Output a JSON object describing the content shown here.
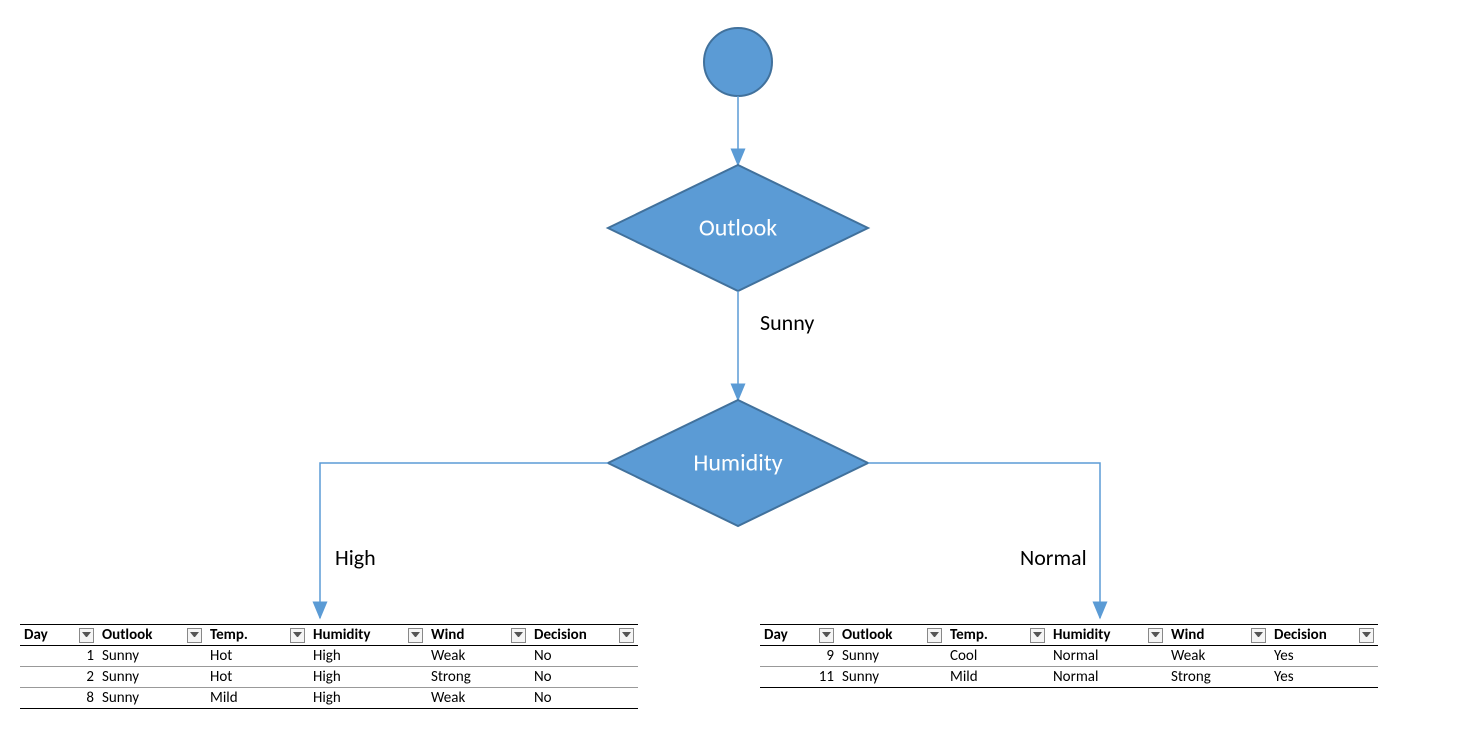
{
  "diagram": {
    "nodes": {
      "start": {
        "type": "circle",
        "label": ""
      },
      "outlook": {
        "type": "diamond",
        "label": "Outlook"
      },
      "humidity": {
        "type": "diamond",
        "label": "Humidity"
      }
    },
    "edges": {
      "start_to_outlook": {
        "label": ""
      },
      "outlook_to_humidity": {
        "label": "Sunny"
      },
      "humidity_to_left": {
        "label": "High"
      },
      "humidity_to_right": {
        "label": "Normal"
      }
    }
  },
  "headers": [
    "Day",
    "Outlook",
    "Temp.",
    "Humidity",
    "Wind",
    "Decision"
  ],
  "left_table": {
    "rows": [
      {
        "day": "1",
        "outlook": "Sunny",
        "temp": "Hot",
        "humidity": "High",
        "wind": "Weak",
        "decision": "No"
      },
      {
        "day": "2",
        "outlook": "Sunny",
        "temp": "Hot",
        "humidity": "High",
        "wind": "Strong",
        "decision": "No"
      },
      {
        "day": "8",
        "outlook": "Sunny",
        "temp": "Mild",
        "humidity": "High",
        "wind": "Weak",
        "decision": "No"
      }
    ]
  },
  "right_table": {
    "rows": [
      {
        "day": "9",
        "outlook": "Sunny",
        "temp": "Cool",
        "humidity": "Normal",
        "wind": "Weak",
        "decision": "Yes"
      },
      {
        "day": "11",
        "outlook": "Sunny",
        "temp": "Mild",
        "humidity": "Normal",
        "wind": "Strong",
        "decision": "Yes"
      }
    ]
  },
  "colors": {
    "node_fill": "#5B9BD5",
    "node_stroke": "#41719C",
    "arrow": "#5B9BD5"
  }
}
